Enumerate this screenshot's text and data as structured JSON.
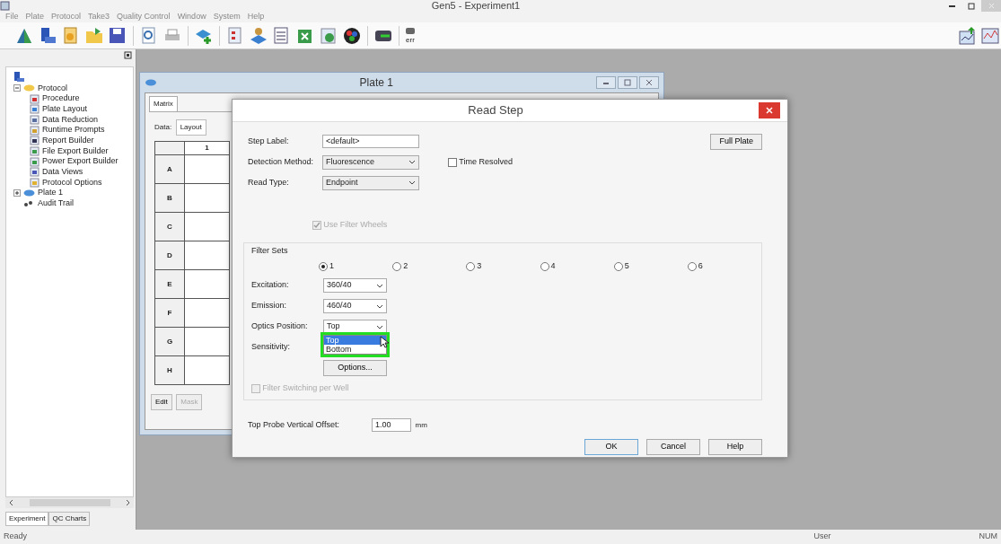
{
  "window": {
    "title": "Gen5 - Experiment1"
  },
  "menu": [
    "File",
    "Plate",
    "Protocol",
    "Take3",
    "Quality Control",
    "Window",
    "System",
    "Help"
  ],
  "toolbar": {
    "status_label": "err"
  },
  "tree": {
    "items": [
      {
        "label": "Protocol",
        "expanded": true,
        "children": [
          {
            "label": "Procedure"
          },
          {
            "label": "Plate Layout"
          },
          {
            "label": "Data Reduction"
          },
          {
            "label": "Runtime Prompts"
          },
          {
            "label": "Report Builder"
          },
          {
            "label": "File Export Builder"
          },
          {
            "label": "Power Export Builder"
          },
          {
            "label": "Data Views"
          },
          {
            "label": "Protocol Options"
          }
        ]
      },
      {
        "label": "Plate 1",
        "expanded": false
      },
      {
        "label": "Audit Trail"
      }
    ]
  },
  "left_tabs": [
    {
      "label": "Experiment",
      "selected": true
    },
    {
      "label": "QC Charts",
      "selected": false
    }
  ],
  "plate_window": {
    "title": "Plate 1",
    "tabs": [
      {
        "label": "Matrix",
        "selected": true
      }
    ],
    "data_label": "Data:",
    "data_value": "Layout",
    "columns": [
      "1"
    ],
    "rows": [
      "A",
      "B",
      "C",
      "D",
      "E",
      "F",
      "G",
      "H"
    ],
    "buttons": [
      {
        "label": "Edit",
        "disabled": false
      },
      {
        "label": "Mask",
        "disabled": true
      }
    ]
  },
  "dialog": {
    "title": "Read Step",
    "step_label": {
      "label": "Step Label:",
      "value": "<default>"
    },
    "full_plate": "Full Plate",
    "detection_method": {
      "label": "Detection Method:",
      "value": "Fluorescence"
    },
    "time_resolved": {
      "label": "Time Resolved",
      "checked": false,
      "disabled": false
    },
    "read_type": {
      "label": "Read Type:",
      "value": "Endpoint"
    },
    "use_filter_wheels": {
      "label": "Use Filter Wheels",
      "checked": true,
      "disabled": true
    },
    "filter_sets": {
      "label": "Filter Sets",
      "options": [
        {
          "label": "1",
          "selected": true
        },
        {
          "label": "2",
          "selected": false
        },
        {
          "label": "3",
          "selected": false
        },
        {
          "label": "4",
          "selected": false
        },
        {
          "label": "5",
          "selected": false
        },
        {
          "label": "6",
          "selected": false
        }
      ]
    },
    "excitation": {
      "label": "Excitation:",
      "value": "360/40"
    },
    "emission": {
      "label": "Emission:",
      "value": "460/40"
    },
    "optics_position": {
      "label": "Optics Position:",
      "value": "Top",
      "expanded": true,
      "options": [
        {
          "label": "Top",
          "selected": true
        },
        {
          "label": "Bottom",
          "selected": false
        }
      ]
    },
    "sensitivity": {
      "label": "Sensitivity:"
    },
    "options_button": "Options...",
    "filter_switching": {
      "label": "Filter Switching per Well",
      "checked": false,
      "disabled": true
    },
    "offset": {
      "label": "Top Probe Vertical Offset:",
      "value": "1.00",
      "unit": "mm"
    },
    "buttons": [
      "OK",
      "Cancel",
      "Help"
    ]
  },
  "status_bar": [
    "Ready",
    "User",
    "NUM"
  ]
}
